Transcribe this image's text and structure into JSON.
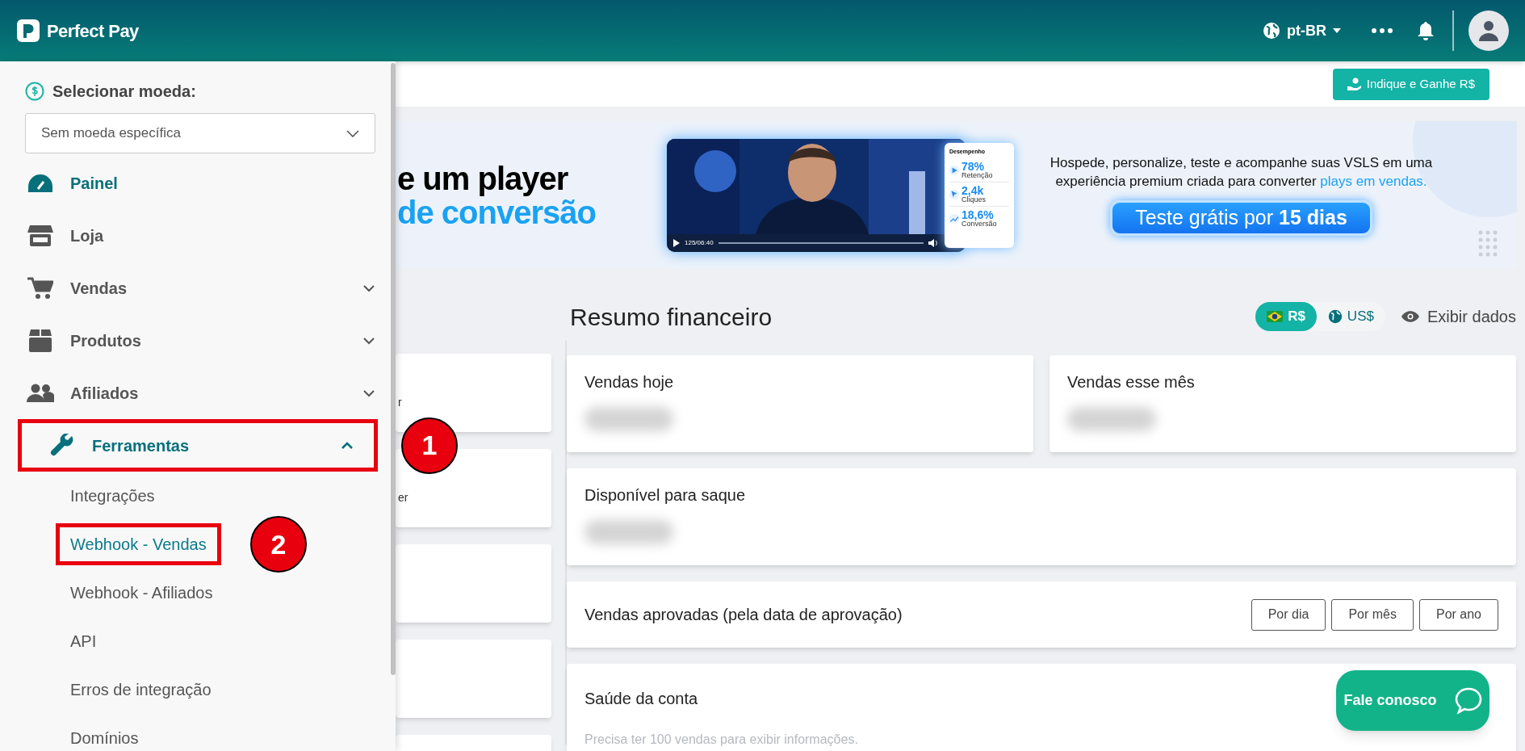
{
  "topbar": {
    "brand": "Perfect Pay",
    "language": "pt-BR"
  },
  "subheader": {
    "button": "Indique e Ganhe R$"
  },
  "sidebar": {
    "currency_label": "Selecionar moeda:",
    "currency_select": {
      "value": "Sem moeda específica"
    },
    "items": [
      {
        "kind": "gauge",
        "label": "Painel",
        "selected": true
      },
      {
        "kind": "store",
        "label": "Loja",
        "selected": false
      },
      {
        "kind": "cart",
        "label": "Vendas",
        "selected": false,
        "expanded": false
      },
      {
        "kind": "box",
        "label": "Produtos",
        "selected": false,
        "expanded": false
      },
      {
        "kind": "users",
        "label": "Afiliados",
        "selected": false,
        "expanded": false
      },
      {
        "kind": "wrench",
        "label": "Ferramentas",
        "selected": true,
        "expanded": true,
        "annotation": "1",
        "children": [
          {
            "label": "Integrações",
            "selected": false
          },
          {
            "label": "Webhook - Vendas",
            "selected": true,
            "annotation": "2"
          },
          {
            "label": "Webhook - Afiliados",
            "selected": false
          },
          {
            "label": "API",
            "selected": false
          },
          {
            "label": "Erros de integração",
            "selected": false
          },
          {
            "label": "Domínios",
            "selected": false
          }
        ]
      }
    ]
  },
  "left_cards": [
    {
      "kind": "text",
      "text": "r"
    },
    {
      "kind": "text",
      "text": "er"
    },
    {
      "kind": "blank"
    },
    {
      "kind": "blank"
    },
    {
      "kind": "blank"
    }
  ],
  "banner": {
    "headline": [
      "e um player",
      "de conversão"
    ],
    "video_time": "125/06:40",
    "stats_title": "Desempenho",
    "stats": [
      {
        "kind": "play",
        "value": "78%",
        "label": "Retenção"
      },
      {
        "kind": "cursor",
        "value": "2,4k",
        "label": "Cliques"
      },
      {
        "kind": "trend",
        "value": "18,6%",
        "label": "Conversão"
      }
    ],
    "description": "Hospede, personalize, teste e acompanhe suas VSLS em uma experiência premium criada para converter",
    "highlight": "plays em vendas.",
    "cta": "Teste grátis por **15 dias**"
  },
  "finance": {
    "title": "Resumo financeiro",
    "currencies": [
      {
        "kind": "brazil",
        "label": "R$",
        "selected": true
      },
      {
        "kind": "globe",
        "label": "US$",
        "selected": false
      }
    ],
    "show_data": "Exibir dados",
    "cards": [
      {
        "title": "Vendas hoje",
        "kind": "half"
      },
      {
        "title": "Vendas esse mês",
        "kind": "half"
      },
      {
        "title": "Disponível para saque",
        "kind": "full"
      }
    ],
    "approved": {
      "title": "Vendas aprovadas (pela data de aprovação)",
      "buttons": [
        "Por dia",
        "Por mês",
        "Por ano"
      ]
    },
    "health": {
      "title": "Saúde da conta",
      "note": "Precisa ter 100 vendas para exibir informações."
    }
  },
  "chat_button": "Fale conosco"
}
